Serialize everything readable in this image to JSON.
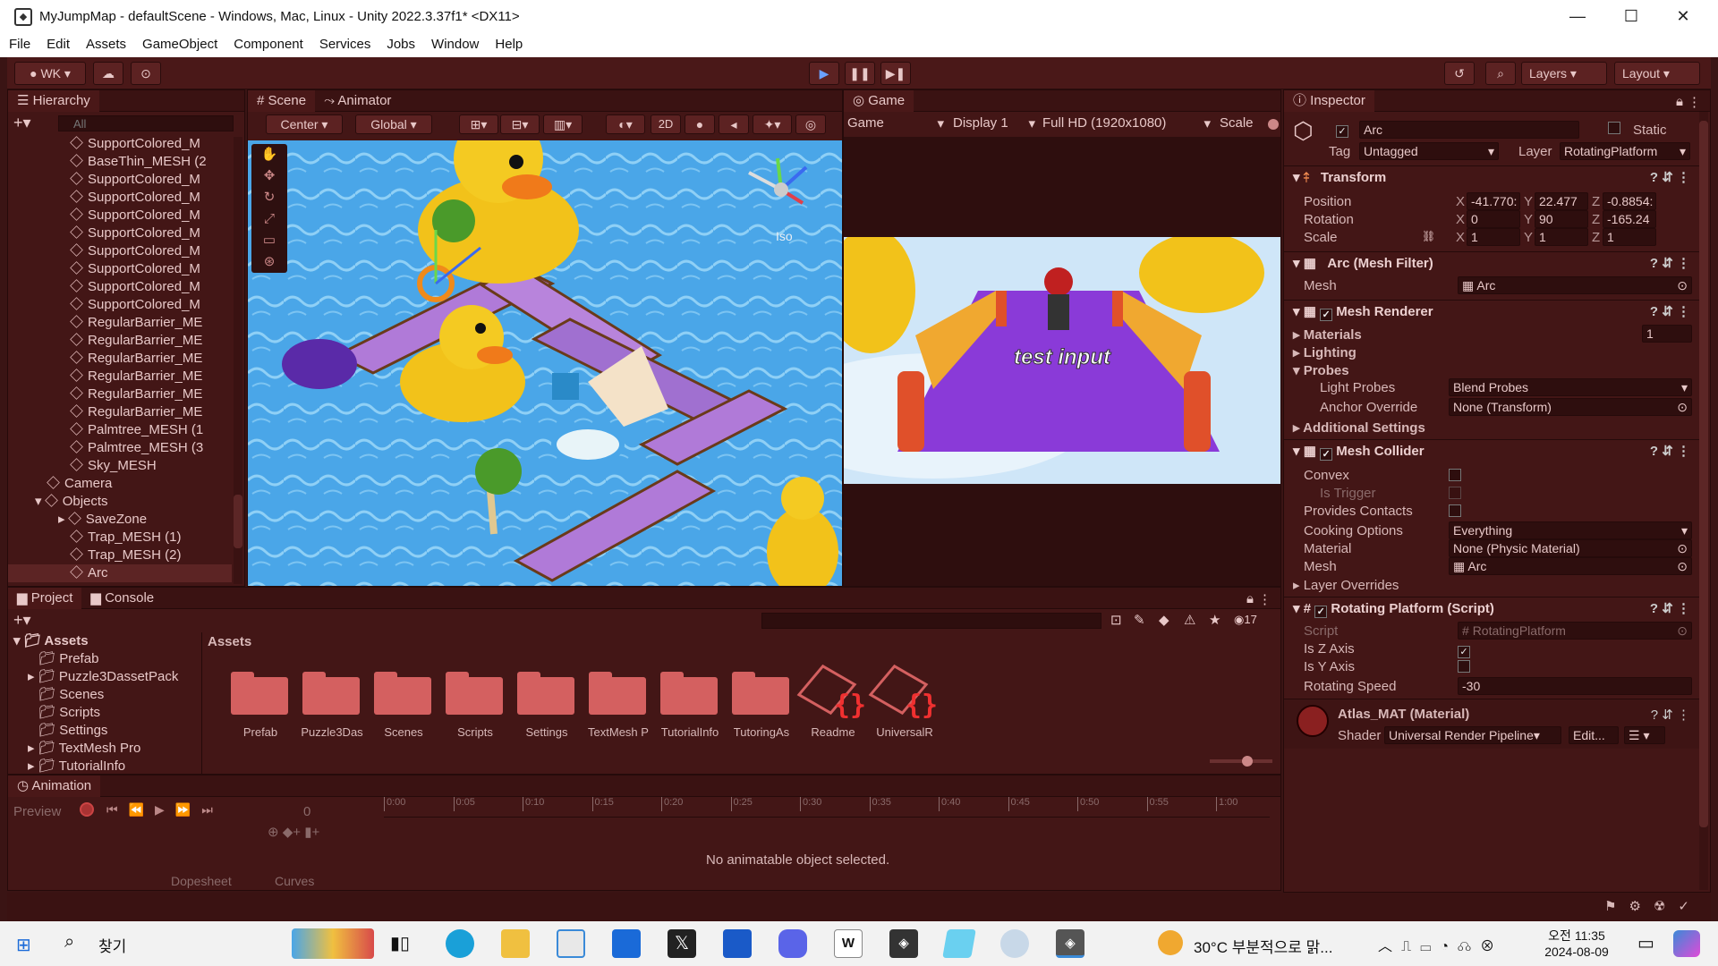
{
  "window": {
    "title": "MyJumpMap - defaultScene - Windows, Mac, Linux - Unity 2022.3.37f1* <DX11>",
    "minimize": "—",
    "maximize": "☐",
    "close": "✕"
  },
  "menu": [
    "File",
    "Edit",
    "Assets",
    "GameObject",
    "Component",
    "Services",
    "Jobs",
    "Window",
    "Help"
  ],
  "toolbar": {
    "account": "WK",
    "layers": "Layers",
    "layout": "Layout"
  },
  "hierarchy": {
    "tab": "Hierarchy",
    "search_placeholder": "All",
    "items": [
      {
        "label": "SupportColored_M",
        "indent": 2
      },
      {
        "label": "BaseThin_MESH (2",
        "indent": 2
      },
      {
        "label": "SupportColored_M",
        "indent": 2
      },
      {
        "label": "SupportColored_M",
        "indent": 2
      },
      {
        "label": "SupportColored_M",
        "indent": 2
      },
      {
        "label": "SupportColored_M",
        "indent": 2
      },
      {
        "label": "SupportColored_M",
        "indent": 2
      },
      {
        "label": "SupportColored_M",
        "indent": 2
      },
      {
        "label": "SupportColored_M",
        "indent": 2
      },
      {
        "label": "SupportColored_M",
        "indent": 2
      },
      {
        "label": "RegularBarrier_ME",
        "indent": 2
      },
      {
        "label": "RegularBarrier_ME",
        "indent": 2
      },
      {
        "label": "RegularBarrier_ME",
        "indent": 2
      },
      {
        "label": "RegularBarrier_ME",
        "indent": 2
      },
      {
        "label": "RegularBarrier_ME",
        "indent": 2
      },
      {
        "label": "RegularBarrier_ME",
        "indent": 2
      },
      {
        "label": "Palmtree_MESH (1",
        "indent": 2
      },
      {
        "label": "Palmtree_MESH (3",
        "indent": 2
      },
      {
        "label": "Sky_MESH",
        "indent": 2
      },
      {
        "label": "Camera",
        "indent": 1
      },
      {
        "label": "Objects",
        "indent": 1
      },
      {
        "label": "SaveZone",
        "indent": 2
      },
      {
        "label": "Trap_MESH (1)",
        "indent": 2
      },
      {
        "label": "Trap_MESH (2)",
        "indent": 2
      },
      {
        "label": "Arc",
        "indent": 2
      }
    ]
  },
  "scene": {
    "tab": "Scene",
    "tab2": "Animator",
    "pivot": "Center",
    "space": "Global",
    "mode2d": "2D",
    "iso": "Iso"
  },
  "game": {
    "tab": "Game",
    "mode": "Game",
    "display": "Display 1",
    "resolution": "Full HD (1920x1080)",
    "scale": "Scale",
    "overlay_text": "test input"
  },
  "inspector": {
    "tab": "Inspector",
    "name": "Arc",
    "static": "Static",
    "tag_label": "Tag",
    "tag": "Untagged",
    "layer_label": "Layer",
    "layer": "RotatingPlatform",
    "transform": {
      "title": "Transform",
      "position_label": "Position",
      "rotation_label": "Rotation",
      "scale_label": "Scale",
      "position": [
        "-41.770:",
        "22.477",
        "-0.8854:"
      ],
      "rotation": [
        "0",
        "90",
        "-165.24"
      ],
      "scale": [
        "1",
        "1",
        "1"
      ]
    },
    "mesh_filter": {
      "title": "Arc (Mesh Filter)",
      "mesh_label": "Mesh",
      "mesh": "Arc"
    },
    "mesh_renderer": {
      "title": "Mesh Renderer",
      "materials": "Materials",
      "materials_count": "1",
      "lighting": "Lighting",
      "probes": "Probes",
      "light_probes_label": "Light Probes",
      "light_probes": "Blend Probes",
      "anchor_label": "Anchor Override",
      "anchor": "None (Transform)",
      "additional": "Additional Settings"
    },
    "mesh_collider": {
      "title": "Mesh Collider",
      "convex": "Convex",
      "is_trigger": "Is Trigger",
      "provides_contacts": "Provides Contacts",
      "cooking_label": "Cooking Options",
      "cooking": "Everything",
      "material_label": "Material",
      "material": "None (Physic Material)",
      "mesh_label": "Mesh",
      "mesh": "Arc",
      "layer_overrides": "Layer Overrides"
    },
    "rotating": {
      "title": "Rotating Platform (Script)",
      "script_label": "Script",
      "script": "RotatingPlatform",
      "z_axis": "Is Z Axis",
      "y_axis": "Is Y Axis",
      "speed_label": "Rotating Speed",
      "speed": "-30"
    },
    "material": {
      "title": "Atlas_MAT (Material)",
      "shader_label": "Shader",
      "shader": "Universal Render Pipeline",
      "edit": "Edit..."
    }
  },
  "project": {
    "tab": "Project",
    "tab2": "Console",
    "count": "17",
    "root": "Assets",
    "breadcrumb": "Assets",
    "tree": [
      "Prefab",
      "Puzzle3DassetPack",
      "Scenes",
      "Scripts",
      "Settings",
      "TextMesh Pro",
      "TutorialInfo"
    ],
    "assets": [
      "Prefab",
      "Puzzle3Das",
      "Scenes",
      "Scripts",
      "Settings",
      "TextMesh P",
      "TutorialInfo",
      "TutoringAs",
      "Readme",
      "UniversalR"
    ]
  },
  "animation": {
    "tab": "Animation",
    "preview": "Preview",
    "frame": "0",
    "empty": "No animatable object selected.",
    "dopesheet": "Dopesheet",
    "curves": "Curves",
    "ticks": [
      "0:00",
      "0:05",
      "0:10",
      "0:15",
      "0:20",
      "0:25",
      "0:30",
      "0:35",
      "0:40",
      "0:45",
      "0:50",
      "0:55",
      "1:00"
    ]
  },
  "taskbar": {
    "search": "찾기",
    "weather": "30°C  부분적으로 맑...",
    "time": "오전 11:35",
    "date": "2024-08-09"
  }
}
